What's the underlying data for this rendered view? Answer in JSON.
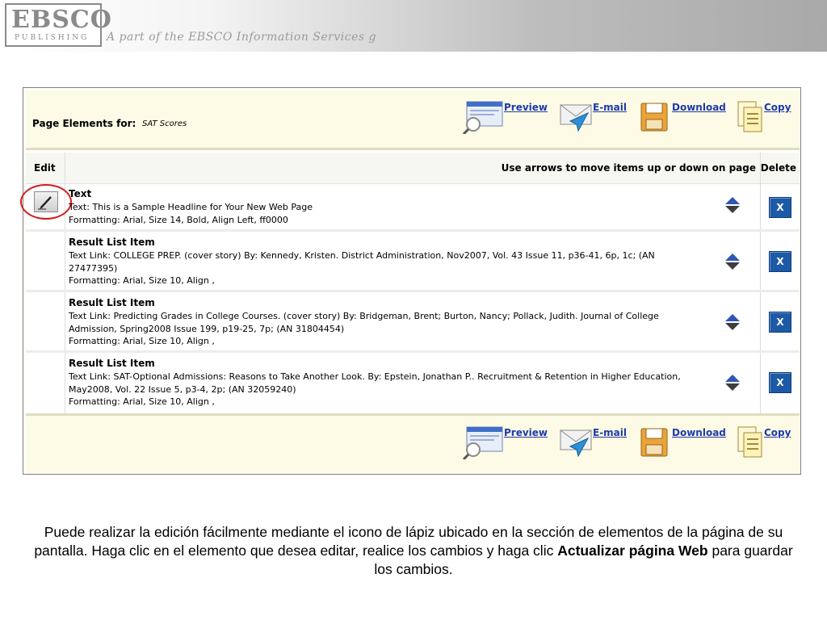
{
  "header": {
    "logo_text": "EBSCO",
    "logo_sub": "PUBLISHING",
    "tagline": "A part of the EBSCO Information Services g"
  },
  "toolbar": {
    "page_elements_label": "Page Elements for:",
    "page_elements_value": "SAT Scores",
    "actions": {
      "preview": "Preview",
      "email": "E-mail",
      "download": "Download",
      "copy": "Copy"
    }
  },
  "table": {
    "headers": {
      "edit": "Edit",
      "instructions": "Use arrows to move items up or down on page",
      "delete": "Delete"
    },
    "rows": [
      {
        "title": "Text",
        "line1": "Text: This is a Sample Headline for Your New Web Page",
        "line2": "Formatting: Arial, Size 14, Bold, Align Left, ff0000",
        "delete_label": "X"
      },
      {
        "title": "Result List Item",
        "line1": "Text Link: COLLEGE PREP. (cover story) By: Kennedy, Kristen. District Administration, Nov2007, Vol. 43 Issue 11, p36-41, 6p, 1c; (AN 27477395)",
        "line2": "Formatting: Arial, Size 10, Align ,",
        "delete_label": "X"
      },
      {
        "title": "Result List Item",
        "line1": "Text Link: Predicting Grades in College Courses. (cover story) By: Bridgeman, Brent; Burton, Nancy; Pollack, Judith. Journal of College Admission, Spring2008 Issue 199, p19-25, 7p; (AN 31804454)",
        "line2": "Formatting: Arial, Size 10, Align ,",
        "delete_label": "X"
      },
      {
        "title": "Result List Item",
        "line1": "Text Link: SAT-Optional Admissions: Reasons to Take Another Look. By: Epstein, Jonathan P.. Recruitment & Retention in Higher Education, May2008, Vol. 22 Issue 5, p3-4, 2p; (AN 32059240)",
        "line2": "Formatting: Arial, Size 10, Align ,",
        "delete_label": "X"
      }
    ]
  },
  "caption": {
    "part1": "Puede realizar la edición fácilmente mediante el icono de lápiz ubicado en la sección de elementos de la página de su pantalla. Haga clic en el elemento que desea editar, realice los cambios y haga clic ",
    "bold": "Actualizar página Web",
    "part2": " para guardar los cambios."
  },
  "colors": {
    "link": "#1e3aa8",
    "delete_button": "#1d5aa6",
    "highlight_circle": "#d11d1d",
    "toolbar_bg": "#fdfbe6"
  },
  "icons": [
    "preview-icon",
    "email-icon",
    "download-icon",
    "copy-icon",
    "pencil-icon",
    "move-arrows-icon"
  ]
}
